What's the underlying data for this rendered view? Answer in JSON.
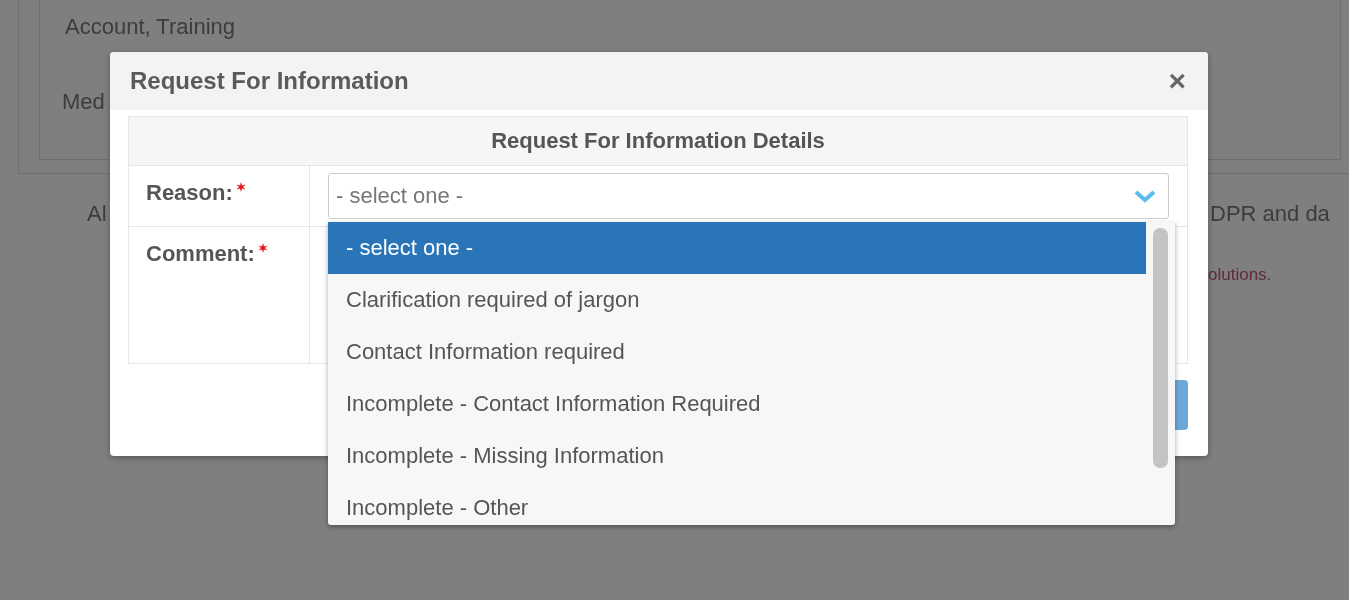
{
  "background": {
    "category_value": "Account, Training",
    "field_label": "Med",
    "paragraph_start": "Al",
    "paragraph_end": "DPR and da",
    "notice_end": "olutions."
  },
  "modal": {
    "title": "Request For Information",
    "close": "×",
    "details_heading": "Request For Information Details",
    "fields": [
      {
        "kind": "select",
        "label": "Reason:",
        "required": true,
        "placeholder": "- select one -"
      },
      {
        "kind": "textarea",
        "label": "Comment:",
        "required": true
      }
    ],
    "dropdown": {
      "options": [
        {
          "label": "- select one -",
          "selected": true
        },
        {
          "label": "Clarification required of jargon",
          "selected": false
        },
        {
          "label": "Contact Information required",
          "selected": false
        },
        {
          "label": "Incomplete - Contact Information Required",
          "selected": false
        },
        {
          "label": "Incomplete - Missing Information",
          "selected": false
        },
        {
          "label": "Incomplete - Other",
          "selected": false
        }
      ]
    }
  }
}
